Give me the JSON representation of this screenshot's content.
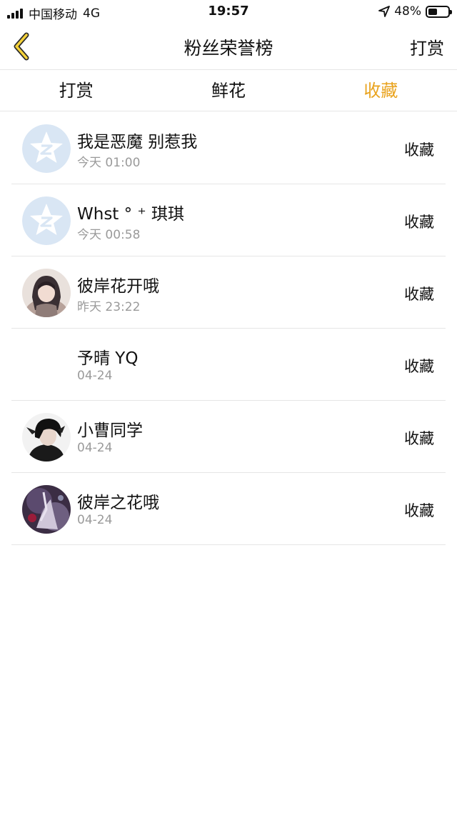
{
  "status_bar": {
    "carrier": "中国移动",
    "network": "4G",
    "time": "19:57",
    "battery": "48%",
    "battery_level": 0.48
  },
  "nav": {
    "title": "粉丝荣誉榜",
    "right_label": "打赏"
  },
  "tabs": [
    {
      "label": "打赏"
    },
    {
      "label": "鲜花"
    },
    {
      "label": "收藏"
    }
  ],
  "active_tab_color": "#e9a31e",
  "list": [
    {
      "name": "我是恶魔 别惹我",
      "time": "今天 01:00",
      "action": "收藏",
      "avatar": "qq-default-avatar"
    },
    {
      "name": "Whst ° ⁺ 琪琪",
      "time": "今天 00:58",
      "action": "收藏",
      "avatar": "qq-default-avatar"
    },
    {
      "name": "彼岸花开哦",
      "time": "昨天 23:22",
      "action": "收藏",
      "avatar": "user-photo"
    },
    {
      "name": "予晴 YQ",
      "time": "04-24",
      "action": "收藏",
      "avatar": "none"
    },
    {
      "name": "小曹同学",
      "time": "04-24",
      "action": "收藏",
      "avatar": "user-photo"
    },
    {
      "name": "彼岸之花哦",
      "time": "04-24",
      "action": "收藏",
      "avatar": "user-photo"
    }
  ]
}
